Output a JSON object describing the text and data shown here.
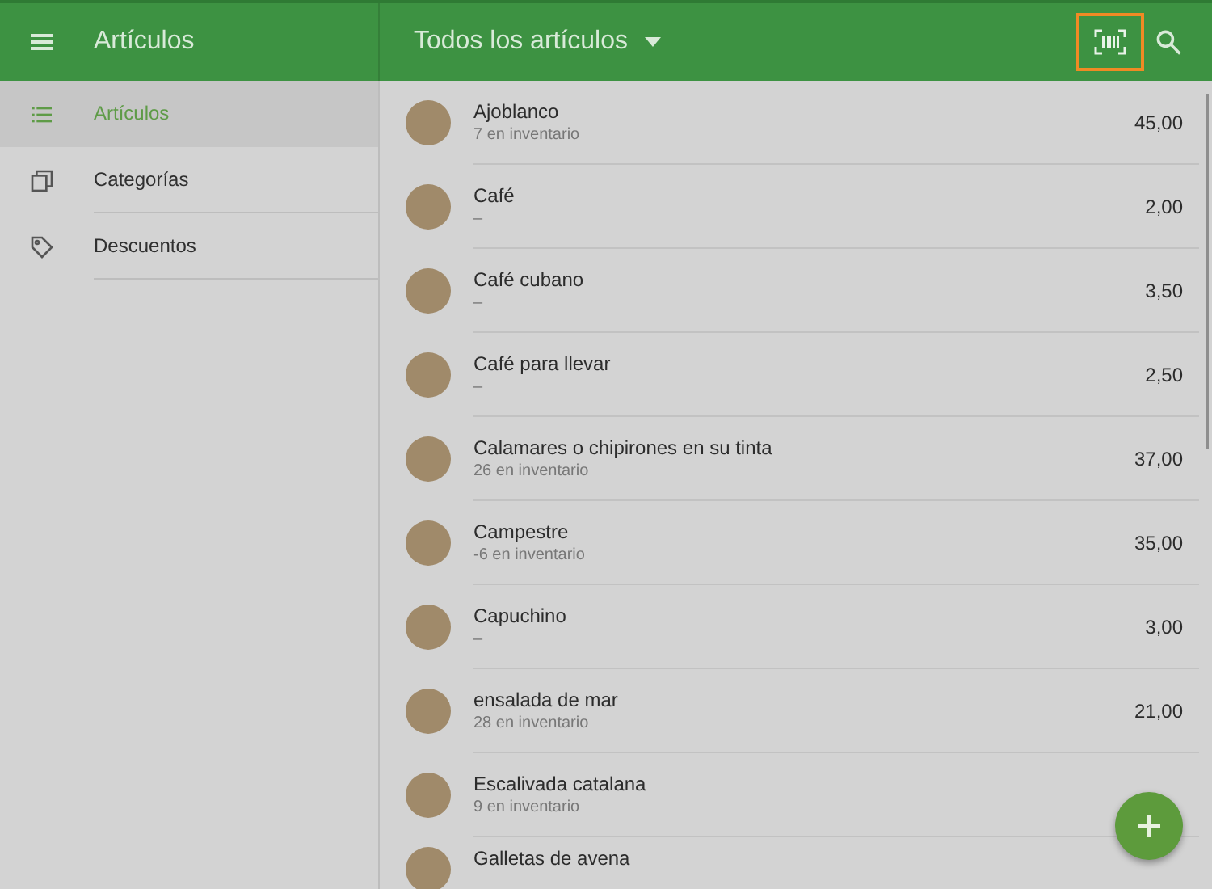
{
  "app_bar": {
    "title": "Artículos",
    "filter": "Todos los artículos",
    "scan_highlighted": true
  },
  "sidebar": {
    "items": [
      {
        "label": "Artículos",
        "kind": "list",
        "selected": true
      },
      {
        "label": "Categorías",
        "kind": "categories",
        "selected": false
      },
      {
        "label": "Descuentos",
        "kind": "tag",
        "selected": false
      }
    ]
  },
  "items": [
    {
      "name": "Ajoblanco",
      "stock": "7 en inventario",
      "price": "45,00"
    },
    {
      "name": "Café",
      "stock": "–",
      "price": "2,00"
    },
    {
      "name": "Café cubano",
      "stock": "–",
      "price": "3,50"
    },
    {
      "name": "Café para llevar",
      "stock": "–",
      "price": "2,50"
    },
    {
      "name": "Calamares o chipirones en su tinta",
      "stock": "26 en inventario",
      "price": "37,00"
    },
    {
      "name": "Campestre",
      "stock": "-6 en inventario",
      "price": "35,00"
    },
    {
      "name": "Capuchino",
      "stock": "–",
      "price": "3,00"
    },
    {
      "name": "ensalada de mar",
      "stock": "28 en inventario",
      "price": "21,00"
    },
    {
      "name": "Escalivada catalana",
      "stock": "9 en inventario"
    },
    {
      "name": "Galletas de avena"
    }
  ]
}
